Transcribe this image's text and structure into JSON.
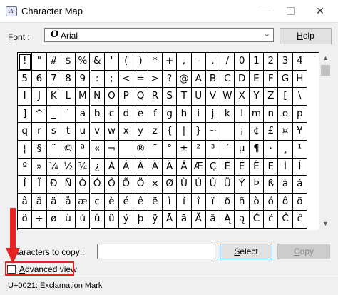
{
  "window": {
    "title": "Character Map",
    "icon_name": "character-map-app-icon",
    "controls": [
      "minimize",
      "maximize",
      "close"
    ]
  },
  "font": {
    "label": "Font :",
    "selected": "Arial",
    "help_label": "Help"
  },
  "grid": {
    "selected_index": 0,
    "characters": [
      "!",
      "\"",
      "#",
      "$",
      "%",
      "&",
      "'",
      "(",
      ")",
      "*",
      "+",
      ",",
      "-",
      ".",
      "/",
      "0",
      "1",
      "2",
      "3",
      "4",
      "5",
      "6",
      "7",
      "8",
      "9",
      ":",
      ";",
      "<",
      "=",
      ">",
      "?",
      "@",
      "A",
      "B",
      "C",
      "D",
      "E",
      "F",
      "G",
      "H",
      "I",
      "J",
      "K",
      "L",
      "M",
      "N",
      "O",
      "P",
      "Q",
      "R",
      "S",
      "T",
      "U",
      "V",
      "W",
      "X",
      "Y",
      "Z",
      "[",
      "\\",
      "]",
      "^",
      "_",
      "`",
      "a",
      "b",
      "c",
      "d",
      "e",
      "f",
      "g",
      "h",
      "i",
      "j",
      "k",
      "l",
      "m",
      "n",
      "o",
      "p",
      "q",
      "r",
      "s",
      "t",
      "u",
      "v",
      "w",
      "x",
      "y",
      "z",
      "{",
      "|",
      "}",
      "~",
      " ",
      "¡",
      "¢",
      "£",
      "¤",
      "¥",
      "¦",
      "§",
      "¨",
      "©",
      "ª",
      "«",
      "¬",
      "­",
      "®",
      "¯",
      "°",
      "±",
      "²",
      "³",
      "´",
      "µ",
      "¶",
      "·",
      "¸",
      "¹",
      "º",
      "»",
      "¼",
      "½",
      "¾",
      "¿",
      "À",
      "Á",
      "Â",
      "Ã",
      "Ä",
      "Å",
      "Æ",
      "Ç",
      "È",
      "É",
      "Ê",
      "Ë",
      "Ì",
      "Í",
      "Î",
      "Ï",
      "Ð",
      "Ñ",
      "Ò",
      "Ó",
      "Ô",
      "Õ",
      "Ö",
      "×",
      "Ø",
      "Ù",
      "Ú",
      "Û",
      "Ü",
      "Ý",
      "Þ",
      "ß",
      "à",
      "á",
      "â",
      "ã",
      "ä",
      "å",
      "æ",
      "ç",
      "è",
      "é",
      "ê",
      "ë",
      "ì",
      "í",
      "î",
      "ï",
      "ð",
      "ñ",
      "ò",
      "ó",
      "ô",
      "õ",
      "ö",
      "÷",
      "ø",
      "ù",
      "ú",
      "û",
      "ü",
      "ý",
      "þ",
      "ÿ",
      "Ā",
      "ā",
      "Ă",
      "ă",
      "Ą",
      "ą",
      "Ć",
      "ć",
      "Ĉ",
      "ĉ"
    ]
  },
  "copy": {
    "label": "Characters to copy :",
    "value": "",
    "select_label": "Select",
    "copy_label": "Copy"
  },
  "advanced": {
    "label": "Advanced view",
    "checked": false
  },
  "status": {
    "text": "U+0021: Exclamation Mark"
  },
  "colors": {
    "highlight": "#e32420",
    "focus_border": "#0078d7",
    "window_bg": "#f0f0f0"
  }
}
